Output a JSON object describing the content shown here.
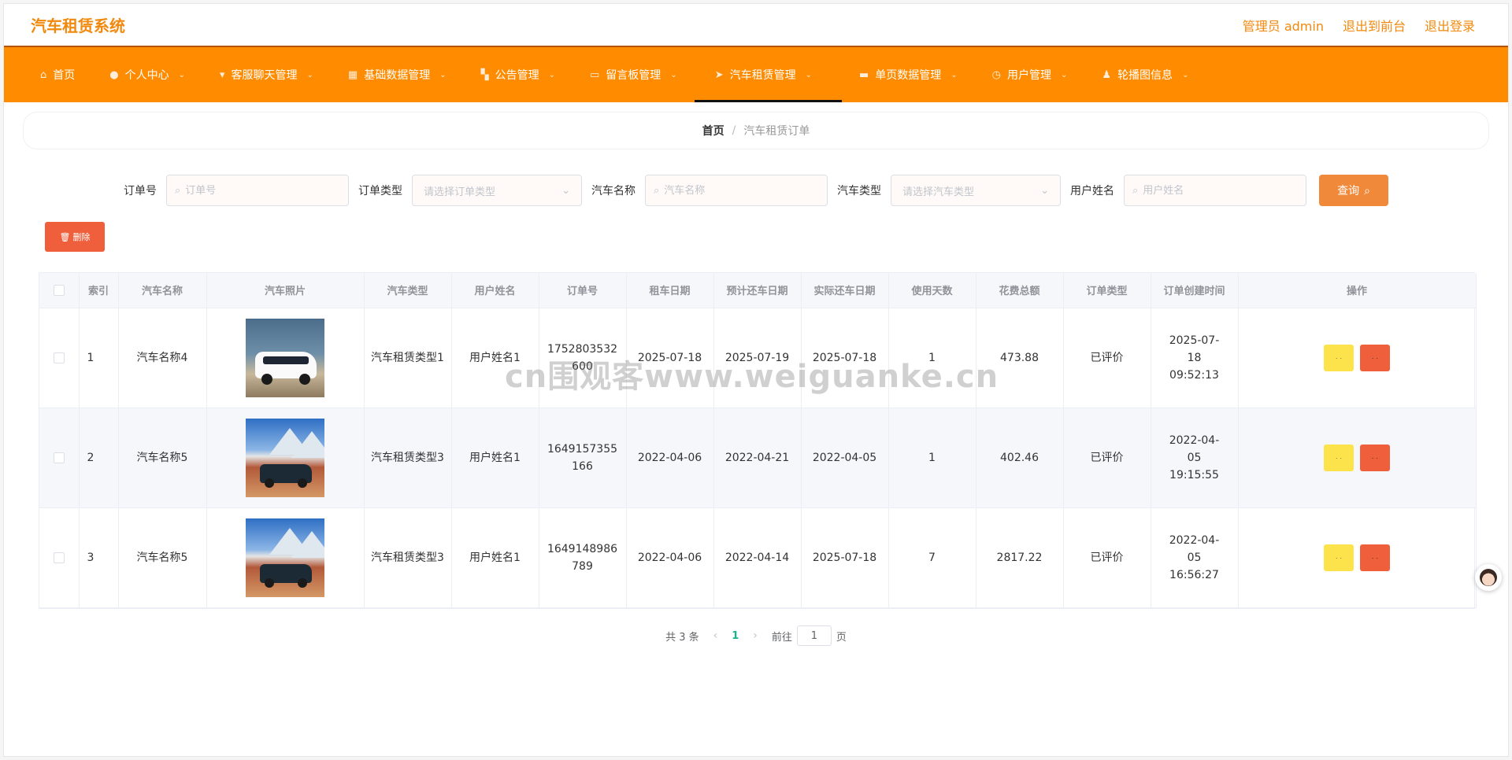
{
  "header": {
    "brand": "汽车租赁系统",
    "admin_label": "管理员 admin",
    "to_front": "退出到前台",
    "logout": "退出登录"
  },
  "nav": {
    "items": [
      {
        "label": "首页",
        "icon": "home-icon"
      },
      {
        "label": "个人中心",
        "icon": "user-icon"
      },
      {
        "label": "客服聊天管理",
        "icon": "mic-icon"
      },
      {
        "label": "基础数据管理",
        "icon": "grid-icon"
      },
      {
        "label": "公告管理",
        "icon": "apps-icon"
      },
      {
        "label": "留言板管理",
        "icon": "message-icon"
      },
      {
        "label": "汽车租赁管理",
        "icon": "navigation-icon"
      },
      {
        "label": "单页数据管理",
        "icon": "film-icon"
      },
      {
        "label": "用户管理",
        "icon": "clock-icon"
      },
      {
        "label": "轮播图信息",
        "icon": "person-icon"
      }
    ],
    "active_index": 6
  },
  "breadcrumb": {
    "home": "首页",
    "separator": "/",
    "current": "汽车租赁订单"
  },
  "search": {
    "order_no_label": "订单号",
    "order_no_placeholder": "订单号",
    "order_type_label": "订单类型",
    "order_type_placeholder": "请选择订单类型",
    "car_name_label": "汽车名称",
    "car_name_placeholder": "汽车名称",
    "car_type_label": "汽车类型",
    "car_type_placeholder": "请选择汽车类型",
    "user_name_label": "用户姓名",
    "user_name_placeholder": "用户姓名",
    "query_button": "查询"
  },
  "actions": {
    "delete_button": "删除"
  },
  "table": {
    "headers": [
      "",
      "索引",
      "汽车名称",
      "汽车照片",
      "汽车类型",
      "用户姓名",
      "订单号",
      "租车日期",
      "预计还车日期",
      "实际还车日期",
      "使用天数",
      "花费总额",
      "订单类型",
      "订单创建时间",
      "操作"
    ],
    "rows": [
      {
        "index": "1",
        "car_name": "汽车名称4",
        "photo": "white-van",
        "car_type": "汽车租赁类型1",
        "user": "用户姓名1",
        "order_no": "1752803532600",
        "rent_date": "2025-07-18",
        "expected_return": "2025-07-19",
        "actual_return": "2025-07-18",
        "days": "1",
        "total": "473.88",
        "order_type": "已评价",
        "created": "2025-07-18 09:52:13"
      },
      {
        "index": "2",
        "car_name": "汽车名称5",
        "photo": "dark-suv",
        "car_type": "汽车租赁类型3",
        "user": "用户姓名1",
        "order_no": "1649157355166",
        "rent_date": "2022-04-06",
        "expected_return": "2022-04-21",
        "actual_return": "2022-04-05",
        "days": "1",
        "total": "402.46",
        "order_type": "已评价",
        "created": "2022-04-05 19:15:55"
      },
      {
        "index": "3",
        "car_name": "汽车名称5",
        "photo": "dark-suv",
        "car_type": "汽车租赁类型3",
        "user": "用户姓名1",
        "order_no": "1649148986789",
        "rent_date": "2022-04-06",
        "expected_return": "2022-04-14",
        "actual_return": "2025-07-18",
        "days": "7",
        "total": "2817.22",
        "order_type": "已评价",
        "created": "2022-04-05 16:56:27"
      }
    ],
    "op_edit_label": "· ·",
    "op_delete_label": "· ·"
  },
  "pagination": {
    "total_text": "共 3 条",
    "current_page": "1",
    "goto_prefix": "前往",
    "goto_value": "1",
    "goto_suffix": "页"
  },
  "watermark": "cn围观客www.weiguanke.cn",
  "colors": {
    "nav_bg": "#ff8c00",
    "brand": "#f0890d",
    "query_btn": "#f08a3a",
    "delete_btn": "#ef5f3c",
    "edit_btn": "#fde34b",
    "page_active": "#15b48a"
  }
}
